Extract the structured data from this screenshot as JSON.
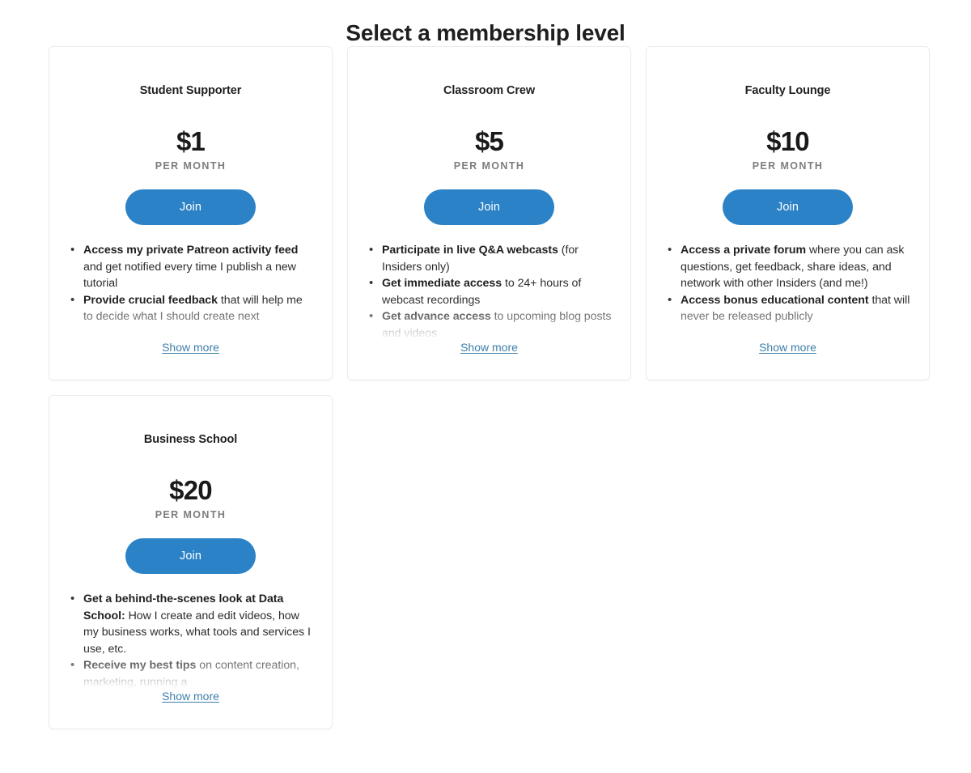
{
  "heading": "Select a membership level",
  "colors": {
    "accent_button": "#2b82c6",
    "link": "#3d7faa",
    "heading_text": "#1f1f1f",
    "period_text": "#7d7d7d",
    "card_border": "#ececec",
    "page_background": "#ffffff"
  },
  "common": {
    "period_label": "PER MONTH",
    "join_label": "Join",
    "show_more_label": "Show more"
  },
  "tiers": [
    {
      "title": "Student Supporter",
      "price": "$1",
      "period": "PER MONTH",
      "join_label": "Join",
      "show_more_label": "Show more",
      "benefits": [
        {
          "bold": "Access my private Patreon activity feed",
          "rest": " and get notified every time I publish a new tutorial"
        },
        {
          "bold": "Provide crucial feedback",
          "rest": " that will help me to decide what I should create next"
        }
      ]
    },
    {
      "title": "Classroom Crew",
      "price": "$5",
      "period": "PER MONTH",
      "join_label": "Join",
      "show_more_label": "Show more",
      "benefits": [
        {
          "bold": "Participate in live Q&A webcasts",
          "rest": " (for Insiders only)"
        },
        {
          "bold": "Get immediate access",
          "rest": " to 24+ hours of webcast recordings"
        },
        {
          "bold": "Get advance access",
          "rest": " to upcoming blog posts and videos"
        }
      ]
    },
    {
      "title": "Faculty Lounge",
      "price": "$10",
      "period": "PER MONTH",
      "join_label": "Join",
      "show_more_label": "Show more",
      "benefits": [
        {
          "bold": "Access a private forum",
          "rest": " where you can ask questions, get feedback, share ideas, and network with other Insiders (and me!)"
        },
        {
          "bold": "Access bonus educational content",
          "rest": " that will never be released publicly"
        }
      ]
    },
    {
      "title": "Business School",
      "price": "$20",
      "period": "PER MONTH",
      "join_label": "Join",
      "show_more_label": "Show more",
      "benefits": [
        {
          "bold": "Get a behind-the-scenes look at Data School:",
          "rest": " How I create and edit videos, how my business works, what tools and services I use, etc."
        },
        {
          "bold": "Receive my best tips",
          "rest": " on content creation, marketing, running a"
        }
      ]
    }
  ]
}
